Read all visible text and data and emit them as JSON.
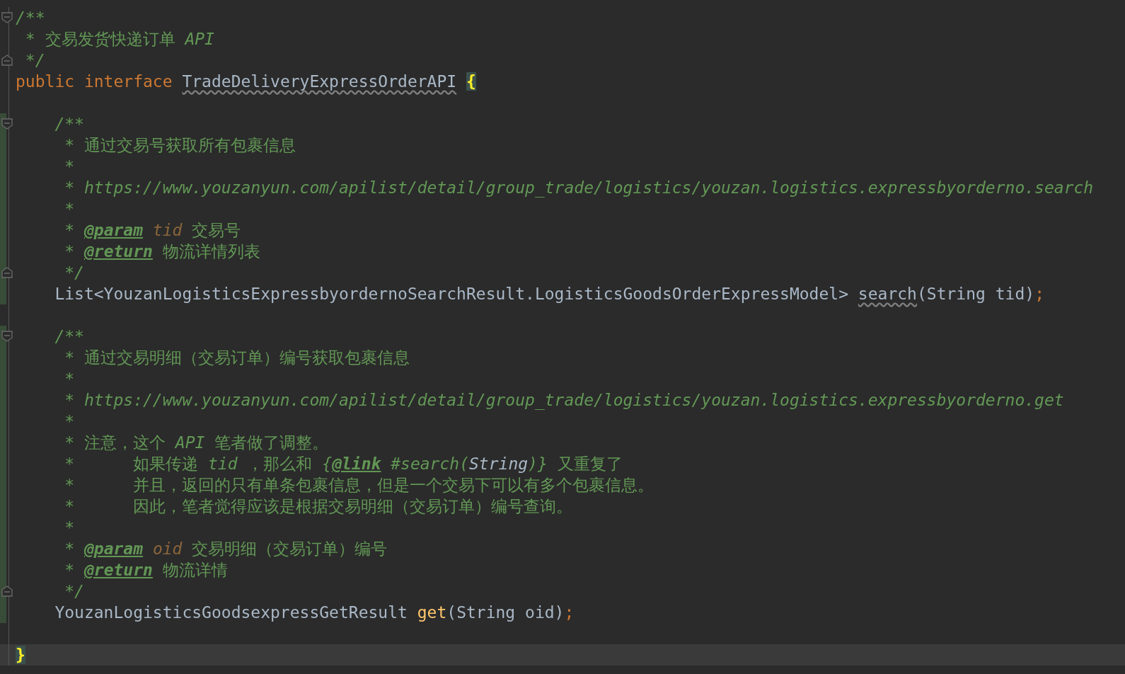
{
  "editor": {
    "lines": [
      {
        "kind": "open",
        "changed": false,
        "current": false,
        "tokens": [
          {
            "text": "/**",
            "kind": "doc"
          }
        ]
      },
      {
        "kind": "line",
        "changed": false,
        "current": false,
        "tokens": [
          {
            "text": " * 交易发货快递订单 ",
            "kind": "doc-cjk"
          },
          {
            "text": "API",
            "kind": "doc"
          }
        ]
      },
      {
        "kind": "close",
        "changed": false,
        "current": false,
        "tokens": [
          {
            "text": " */",
            "kind": "doc"
          }
        ]
      },
      {
        "kind": "line",
        "changed": false,
        "current": false,
        "tokens": [
          {
            "text": "public interface ",
            "kind": "keyword"
          },
          {
            "text": "TradeDeliveryExpressOrderAPI",
            "kind": "unused"
          },
          {
            "text": "{",
            "kind": "brace-match"
          }
        ]
      },
      {
        "kind": "line",
        "changed": false,
        "current": false
      },
      {
        "kind": "open",
        "changed": true,
        "current": false,
        "tokens": [
          {
            "text": "    /**",
            "kind": "doc"
          }
        ]
      },
      {
        "kind": "line",
        "changed": true,
        "current": false,
        "tokens": [
          {
            "text": "     * 通过交易号获取所有包裹信息",
            "kind": "doc-cjk"
          }
        ]
      },
      {
        "kind": "line",
        "changed": true,
        "current": false,
        "tokens": [
          {
            "text": "     *",
            "kind": "doc"
          }
        ]
      },
      {
        "kind": "line",
        "changed": true,
        "current": false,
        "tokens": [
          {
            "text": "     * https://www.youzanyun.com/apilist/detail/group_trade/logistics/youzan.logistics.expressbyorderno.search",
            "kind": "doc"
          }
        ]
      },
      {
        "kind": "line",
        "changed": true,
        "current": false,
        "tokens": [
          {
            "text": "     *",
            "kind": "doc"
          }
        ]
      },
      {
        "kind": "line",
        "changed": true,
        "current": false,
        "tokens": [
          {
            "text": "     * ",
            "kind": "doc"
          },
          {
            "text": "@param",
            "kind": "doc-tag"
          },
          {
            "text": " tid ",
            "kind": "param"
          },
          {
            "text": "交易号",
            "kind": "doc-cjk"
          }
        ]
      },
      {
        "kind": "line",
        "changed": true,
        "current": false,
        "tokens": [
          {
            "text": "     * ",
            "kind": "doc"
          },
          {
            "text": "@return",
            "kind": "doc-tag"
          },
          {
            "text": " 物流详情列表",
            "kind": "doc-cjk"
          }
        ]
      },
      {
        "kind": "close",
        "changed": true,
        "current": false,
        "tokens": [
          {
            "text": "     */",
            "kind": "doc"
          }
        ]
      },
      {
        "kind": "line",
        "changed": true,
        "current": false,
        "tokens": [
          {
            "text": "    List<YouzanLogisticsExpressbyordernoSearchResult.LogisticsGoodsOrderExpressModel> ",
            "kind": "plain"
          },
          {
            "text": "search",
            "kind": "unused"
          },
          {
            "text": "(String tid)",
            "kind": "plain"
          },
          {
            "text": ";",
            "kind": "semi"
          }
        ]
      },
      {
        "kind": "line",
        "changed": false,
        "current": false
      },
      {
        "kind": "open",
        "changed": true,
        "current": false,
        "tokens": [
          {
            "text": "    /**",
            "kind": "doc"
          }
        ]
      },
      {
        "kind": "line",
        "changed": true,
        "current": false,
        "tokens": [
          {
            "text": "     * 通过交易明细（交易订单）编号获取包裹信息",
            "kind": "doc-cjk"
          }
        ]
      },
      {
        "kind": "line",
        "changed": true,
        "current": false,
        "tokens": [
          {
            "text": "     *",
            "kind": "doc"
          }
        ]
      },
      {
        "kind": "line",
        "changed": true,
        "current": false,
        "tokens": [
          {
            "text": "     * https://www.youzanyun.com/apilist/detail/group_trade/logistics/youzan.logistics.expressbyorderno.get",
            "kind": "doc"
          }
        ]
      },
      {
        "kind": "line",
        "changed": true,
        "current": false,
        "tokens": [
          {
            "text": "     *",
            "kind": "doc"
          }
        ]
      },
      {
        "kind": "line",
        "changed": true,
        "current": false,
        "tokens": [
          {
            "text": "     * 注意，这个 ",
            "kind": "doc-cjk"
          },
          {
            "text": "API",
            "kind": "doc"
          },
          {
            "text": " 笔者做了调整。",
            "kind": "doc-cjk"
          }
        ]
      },
      {
        "kind": "line",
        "changed": true,
        "current": false,
        "tokens": [
          {
            "text": "     *      如果传递 ",
            "kind": "doc-cjk"
          },
          {
            "text": "tid",
            "kind": "doc"
          },
          {
            "text": " ，那么和 ",
            "kind": "doc-cjk"
          },
          {
            "text": "{",
            "kind": "doc"
          },
          {
            "text": "@link",
            "kind": "doc-tag"
          },
          {
            "text": " #search(",
            "kind": "doc"
          },
          {
            "text": "String",
            "kind": "doc-ref"
          },
          {
            "text": ")}",
            "kind": "doc"
          },
          {
            "text": " 又重复了",
            "kind": "doc-cjk"
          }
        ]
      },
      {
        "kind": "line",
        "changed": true,
        "current": false,
        "tokens": [
          {
            "text": "     *      并且，返回的只有单条包裹信息，但是一个交易下可以有多个包裹信息。",
            "kind": "doc-cjk"
          }
        ]
      },
      {
        "kind": "line",
        "changed": true,
        "current": false,
        "tokens": [
          {
            "text": "     *      因此，笔者觉得应该是根据交易明细（交易订单）编号查询。",
            "kind": "doc-cjk"
          }
        ]
      },
      {
        "kind": "line",
        "changed": true,
        "current": false,
        "tokens": [
          {
            "text": "     *",
            "kind": "doc"
          }
        ]
      },
      {
        "kind": "line",
        "changed": true,
        "current": false,
        "tokens": [
          {
            "text": "     * ",
            "kind": "doc"
          },
          {
            "text": "@param",
            "kind": "doc-tag"
          },
          {
            "text": " oid ",
            "kind": "param"
          },
          {
            "text": "交易明细（交易订单）编号",
            "kind": "doc-cjk"
          }
        ]
      },
      {
        "kind": "line",
        "changed": true,
        "current": false,
        "tokens": [
          {
            "text": "     * ",
            "kind": "doc"
          },
          {
            "text": "@return",
            "kind": "doc-tag"
          },
          {
            "text": " 物流详情",
            "kind": "doc-cjk"
          }
        ]
      },
      {
        "kind": "close",
        "changed": true,
        "current": false,
        "tokens": [
          {
            "text": "     */",
            "kind": "doc"
          }
        ]
      },
      {
        "kind": "line",
        "changed": true,
        "current": false,
        "tokens": [
          {
            "text": "    YouzanLogisticsGoodsexpressGetResult ",
            "kind": "plain"
          },
          {
            "text": "get",
            "kind": "method"
          },
          {
            "text": "(String oid)",
            "kind": "plain"
          },
          {
            "text": ";",
            "kind": "semi"
          }
        ]
      },
      {
        "kind": "line",
        "changed": false,
        "current": false
      },
      {
        "kind": "line",
        "changed": false,
        "current": true,
        "tokens": [
          {
            "text": "}",
            "kind": "brace-match"
          }
        ]
      }
    ]
  }
}
